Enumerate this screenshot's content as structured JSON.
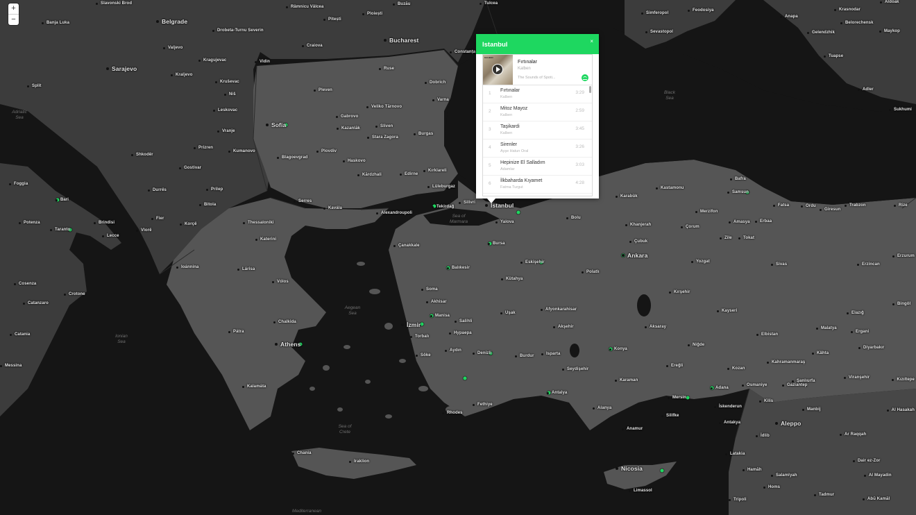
{
  "zoom": {
    "in_label": "+",
    "out_label": "−"
  },
  "popup": {
    "city": "Istanbul",
    "close_label": "×",
    "now_playing": {
      "cover_text": "KALBEN",
      "title": "Fırtınalar",
      "artist": "Kalben",
      "album": "The Sounds of Spoti..."
    },
    "tracks": [
      {
        "num": "1",
        "title": "Fırtınalar",
        "artist": "Kalben",
        "duration": "3:29"
      },
      {
        "num": "2",
        "title": "Mitoz Mayoz",
        "artist": "Kalben",
        "duration": "2:59"
      },
      {
        "num": "3",
        "title": "Taşikardi",
        "artist": "Kalben",
        "duration": "3:45"
      },
      {
        "num": "4",
        "title": "Sirenler",
        "artist": "Ayşe Hatun Oral",
        "duration": "3:26"
      },
      {
        "num": "5",
        "title": "Hepinize El Salladım",
        "artist": "Adamlar",
        "duration": "3:03"
      },
      {
        "num": "6",
        "title": "İlkbaharda Kıyamet",
        "artist": "Fatma Turgut",
        "duration": "4:28"
      }
    ]
  },
  "seas": [
    "Adriatic\nSea",
    "Ionian\nSea",
    "Aegean\nSea",
    "Sea of\nCrete",
    "Sea of\nMarmara",
    "Black\nSea",
    "Mediterranean"
  ],
  "cities": [
    "Slavonski Brod",
    "Belgrade",
    "Banja Luka",
    "Drobeta-Turnu Severin",
    "Râmnicu Vâlcea",
    "Pitești",
    "Ploiești",
    "Buzău",
    "Bucharest",
    "Craiova",
    "Constanța",
    "Tulcea",
    "Simferopol",
    "Feodosiya",
    "Sevastopol",
    "Krasnodar",
    "Anapa",
    "Gelendzhik",
    "Belorechensk",
    "Maykop",
    "Tuapse",
    "Adler",
    "Sukhumi",
    "Valjevo",
    "Sarajevo",
    "Kragujevac",
    "Kraljevo",
    "Kruševac",
    "Niš",
    "Leskovac",
    "Vranje",
    "Split",
    "Vidin",
    "Ruse",
    "Dobrich",
    "Varna",
    "Pleven",
    "Veliko Tărnovo",
    "Gabrovo",
    "Sofia",
    "Kazanlăk",
    "Sliven",
    "Stara Zagora",
    "Burgas",
    "Shkodër",
    "Prizren",
    "Kumanovo",
    "Gostivar",
    "Blagoevgrad",
    "Plovdiv",
    "Haskovo",
    "Kărdzhali",
    "Edirne",
    "Kırklareli",
    "Lüleburgaz",
    "Tekirdağ",
    "Durrës",
    "Prilep",
    "Foggia",
    "Bari",
    "Bitola",
    "Serres",
    "Kavála",
    "Alexandroupoli",
    "Silivri",
    "Istanbul",
    "Yalova",
    "Potenza",
    "Taranto",
    "Brindisi",
    "Fier",
    "Korçë",
    "Thessaloniki",
    "Vlorë",
    "Lecce",
    "Katerini",
    "Çanakkale",
    "Bursa",
    "Balıkesir",
    "Eskişehir",
    "Ioánnina",
    "Lárisa",
    "Vólos",
    "Cosenza",
    "Crotone",
    "Catanzaro",
    "Chalkida",
    "Manisa",
    "İzmir",
    "Athens",
    "Pátra",
    "Akhisar",
    "Soma",
    "Salihli",
    "Torbalı",
    "Hypaepa",
    "Söke",
    "Aydın",
    "Denizli",
    "Kalamáta",
    "Messina",
    "Catania",
    "Rhodes",
    "Fethiye",
    "Chania",
    "Iraklion",
    "Kütahya",
    "Uşak",
    "Afyonkarahisar",
    "Akşehir",
    "Burdur",
    "Isparta",
    "Seydişehir",
    "Antalya",
    "Alanya",
    "Konya",
    "Karaman",
    "Ereğli",
    "Aksaray",
    "Niğde",
    "Kırşehir",
    "Bolu",
    "Karabük",
    "Kastamonu",
    "Khanjerah",
    "Çorum",
    "Merzifon",
    "Amasya",
    "Erbaa",
    "Zile",
    "Tokat",
    "Çubuk",
    "Polatlı",
    "Ankara",
    "Yozgat",
    "Sivas",
    "Kayseri",
    "Bafra",
    "Samsun",
    "Fatsa",
    "Ordu",
    "Giresun",
    "Trabzon",
    "Rize",
    "Erzincan",
    "Erzurum",
    "Bingöl",
    "Elazığ",
    "Malatya",
    "Ergani",
    "Diyarbakır",
    "Elbistan",
    "Kâhta",
    "Kahramanmaraş",
    "Şanlıurfa",
    "Viranşehir",
    "Kızıltepe",
    "Adana",
    "Mersin",
    "Kozan",
    "Osmaniye",
    "Gaziantep",
    "İskenderun",
    "Kilis",
    "Silifke",
    "Anamur",
    "Antakya",
    "Aleppo",
    "Manbij",
    "Al Hasakah",
    "İdlib",
    "Ar Raqqah",
    "Latakia",
    "Nicosia",
    "Limassol",
    "Hamāh",
    "Dair ez-Zor",
    "Salamlyah",
    "Al Mayadin",
    "Homs",
    "Tadmur",
    "Abū Kamāl",
    "Tripoli",
    "Aldoak"
  ]
}
